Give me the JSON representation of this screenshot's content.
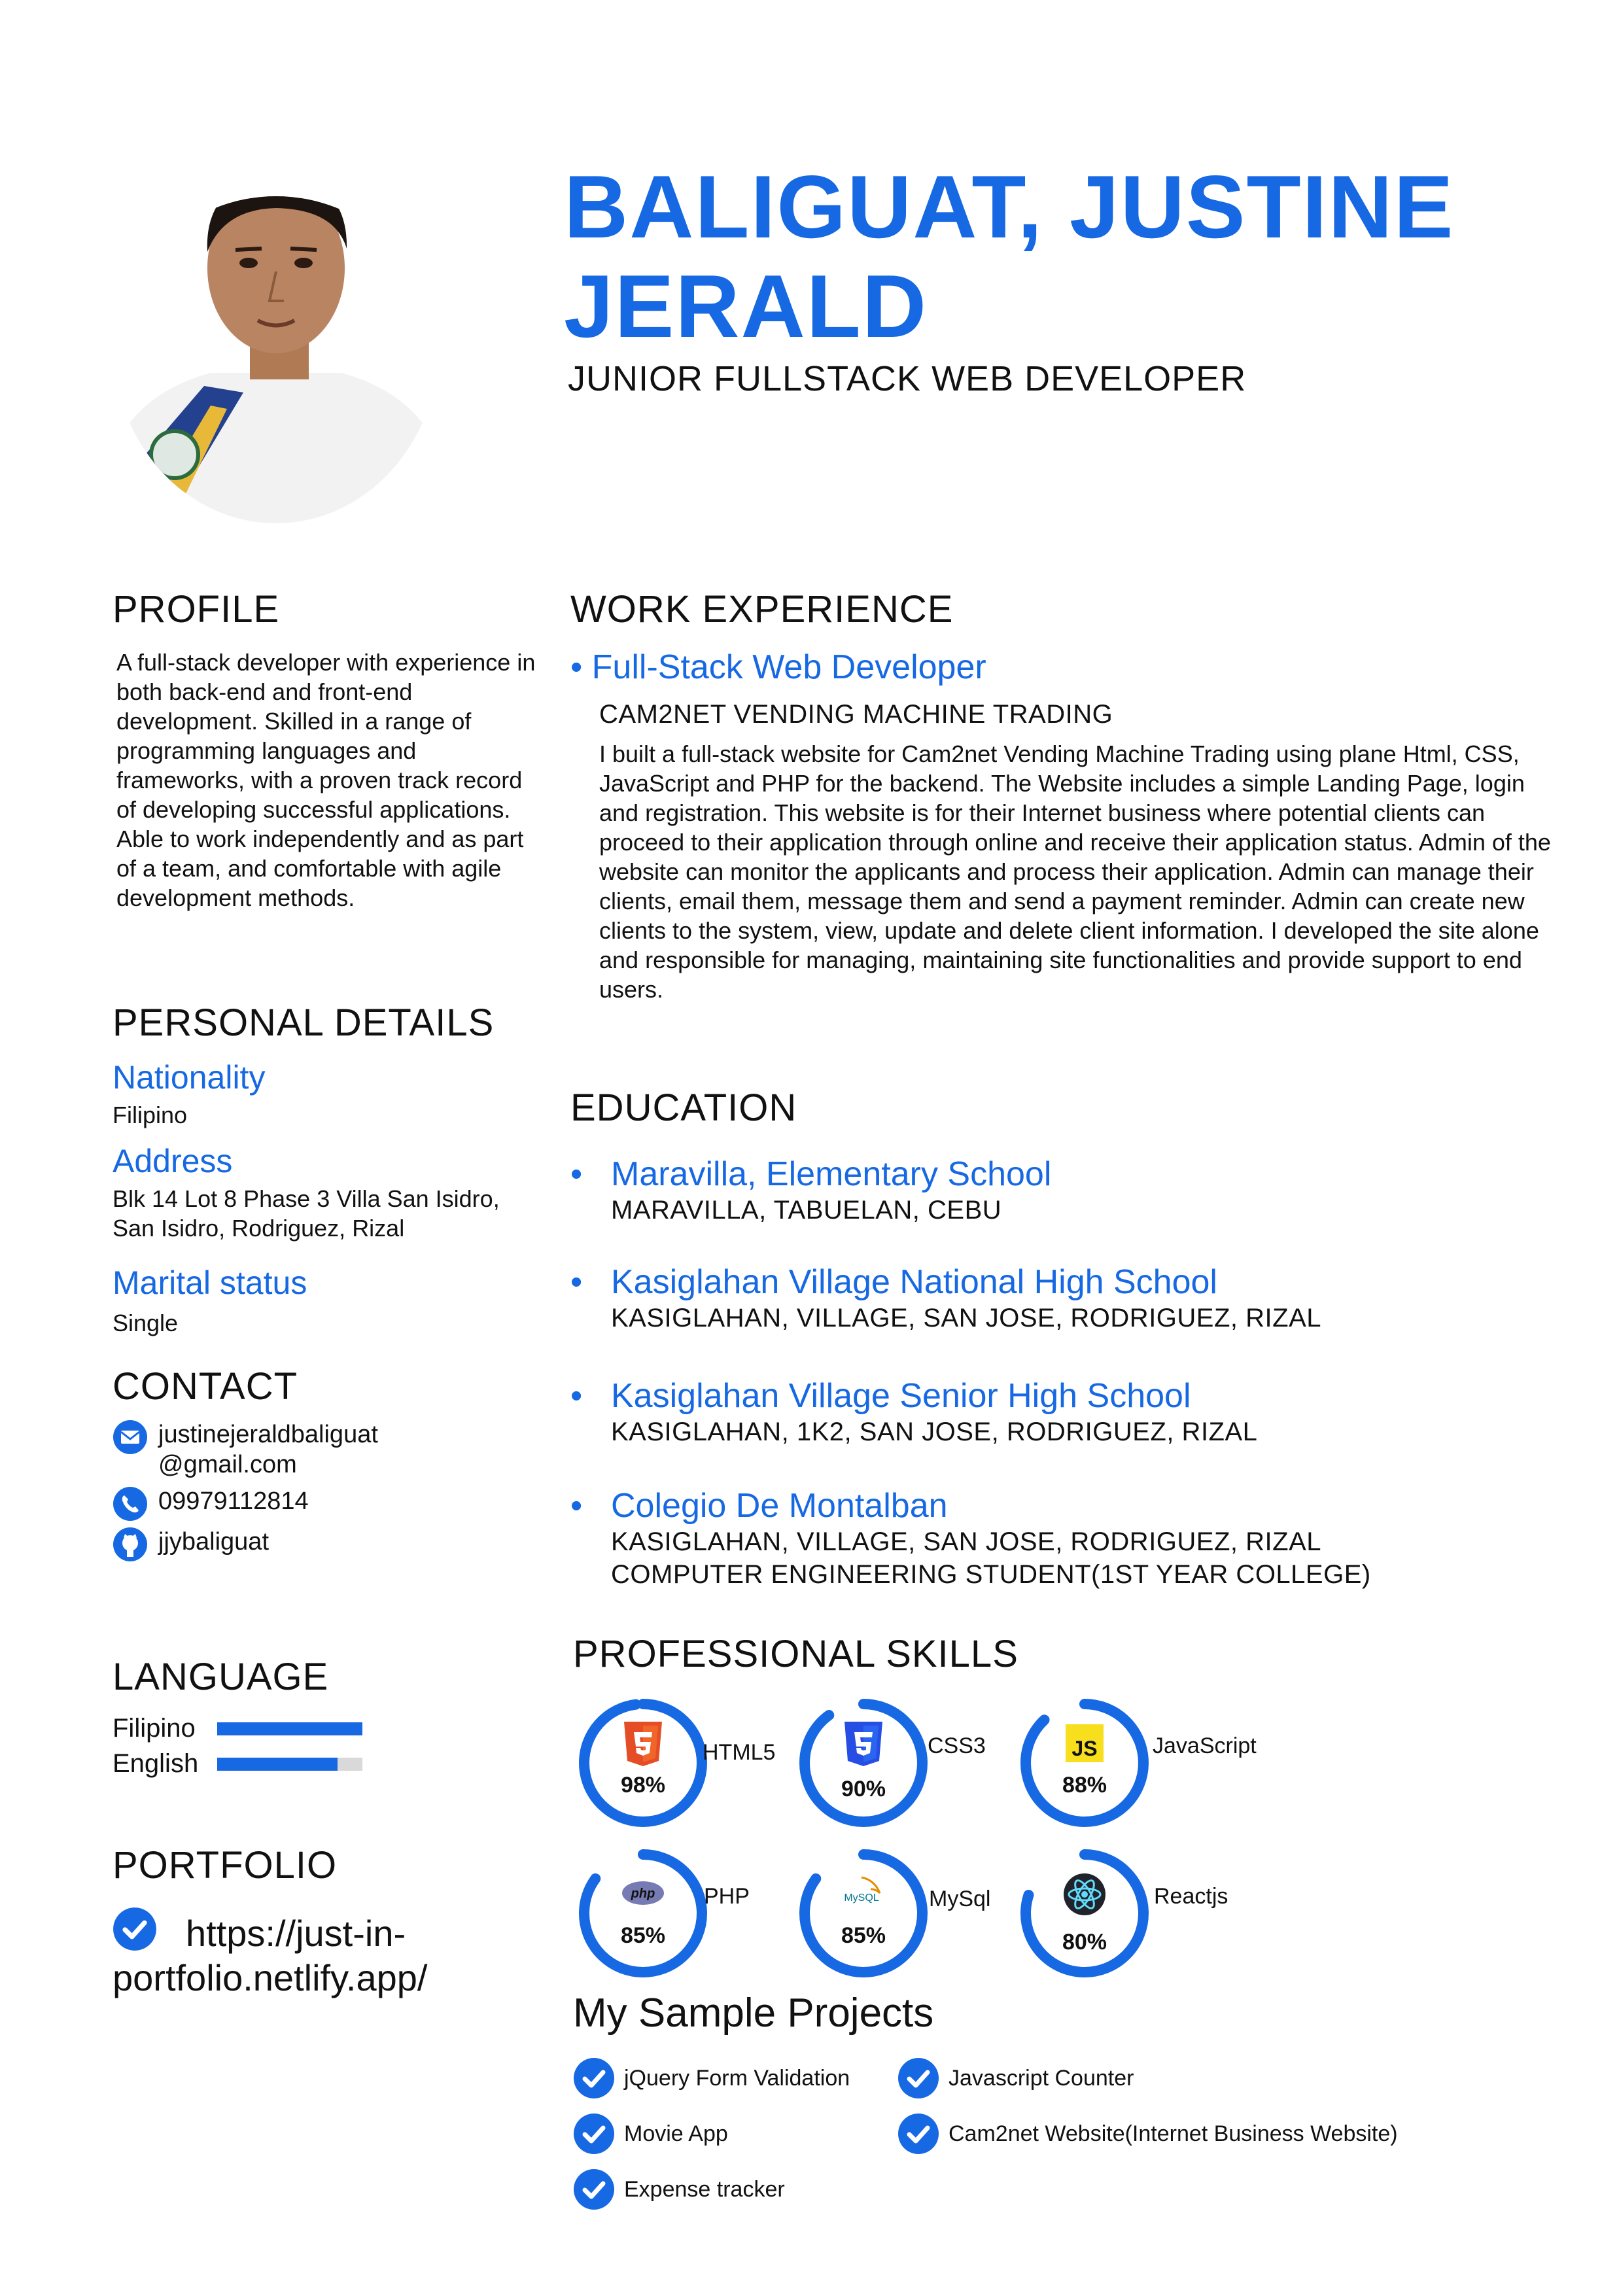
{
  "header": {
    "name": "BALIGUAT, JUSTINE JERALD",
    "title": "JUNIOR FULLSTACK WEB DEVELOPER"
  },
  "profile": {
    "title": "PROFILE",
    "text": "A full-stack developer with experience in both back-end and front-end development. Skilled in a range of programming languages and frameworks, with a proven track record of developing successful applications. Able to work independently and as part of a team, and comfortable with agile development methods."
  },
  "personal": {
    "title": "PERSONAL DETAILS",
    "nationality_label": "Nationality",
    "nationality": "Filipino",
    "address_label": "Address",
    "address": "Blk 14 Lot 8 Phase 3 Villa San Isidro, San Isidro, Rodriguez, Rizal",
    "marital_label": "Marital status",
    "marital": "Single"
  },
  "contact": {
    "title": "CONTACT",
    "email_line1": "justinejeraldbaliguat",
    "email_line2": "@gmail.com",
    "phone": "09979112814",
    "github": "jjybaliguat"
  },
  "language": {
    "title": "LANGUAGE",
    "items": [
      {
        "name": "Filipino",
        "level": 1.0
      },
      {
        "name": "English",
        "level": 0.83
      }
    ]
  },
  "portfolio": {
    "title": "PORTFOLIO",
    "link": "https://just-in-portfolio.netlify.app/"
  },
  "work": {
    "title": "WORK EXPERIENCE",
    "role": "• Full-Stack Web Developer",
    "company": "CAM2NET VENDING MACHINE TRADING",
    "description": "I built a full-stack website for Cam2net Vending Machine Trading using plane Html, CSS, JavaScript and PHP for the backend. The Website includes a simple Landing Page, login and registration. This website is for their Internet business where potential clients can proceed to their application through online and receive their application status. Admin of the website can monitor the applicants and process their application. Admin can manage their clients, email them, message them and send a payment reminder. Admin can create new clients to the system, view, update and delete client information. I developed the site alone and responsible for managing, maintaining site functionalities and provide support to end users."
  },
  "education": {
    "title": "EDUCATION",
    "items": [
      {
        "school": "Maravilla, Elementary School",
        "location": "MARAVILLA, TABUELAN, CEBU",
        "extra": ""
      },
      {
        "school": "Kasiglahan Village National High School",
        "location": "KASIGLAHAN, VILLAGE, SAN JOSE, RODRIGUEZ, RIZAL",
        "extra": ""
      },
      {
        "school": "Kasiglahan Village Senior High School",
        "location": "KASIGLAHAN, 1K2, SAN JOSE, RODRIGUEZ, RIZAL",
        "extra": ""
      },
      {
        "school": "Colegio De Montalban",
        "location": "KASIGLAHAN, VILLAGE, SAN JOSE, RODRIGUEZ, RIZAL",
        "extra": "COMPUTER ENGINEERING STUDENT(1ST YEAR COLLEGE)"
      }
    ]
  },
  "skills": {
    "title": "PROFESSIONAL SKILLS",
    "accent": "#1668e3",
    "items": [
      {
        "name": "HTML5",
        "percent": 98,
        "pct_label": "98%",
        "icon": "html5-icon"
      },
      {
        "name": "CSS3",
        "percent": 90,
        "pct_label": "90%",
        "icon": "css3-icon"
      },
      {
        "name": "JavaScript",
        "percent": 88,
        "pct_label": "88%",
        "icon": "js-icon"
      },
      {
        "name": "PHP",
        "percent": 85,
        "pct_label": "85%",
        "icon": "php-icon",
        "logo_text": "php"
      },
      {
        "name": "MySql",
        "percent": 85,
        "pct_label": "85%",
        "icon": "mysql-icon",
        "logo_text": "MySQL"
      },
      {
        "name": "Reactjs",
        "percent": 80,
        "pct_label": "80%",
        "icon": "react-icon"
      }
    ]
  },
  "projects": {
    "title": "My Sample Projects",
    "items": [
      "jQuery Form Validation",
      "Javascript Counter",
      "Movie App",
      "Cam2net Website(Internet Business Website)",
      "Expense tracker"
    ]
  }
}
